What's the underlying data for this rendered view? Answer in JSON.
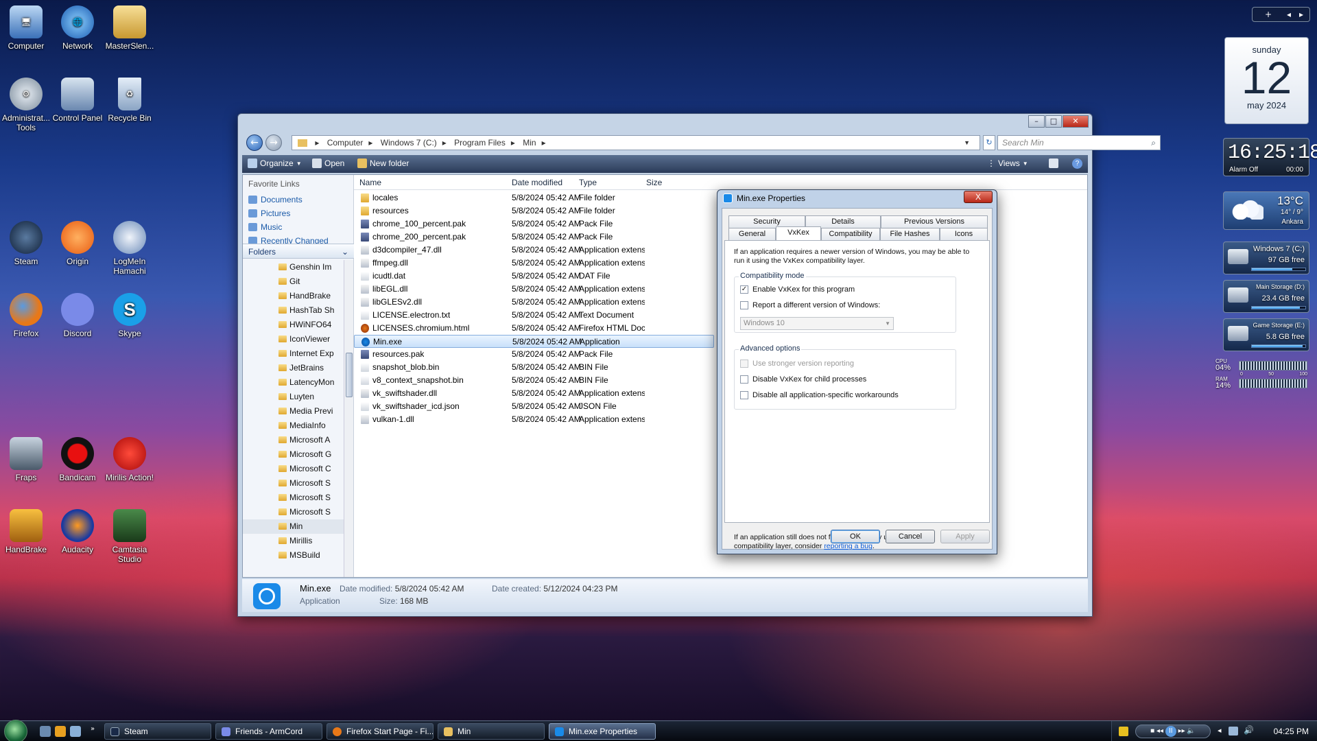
{
  "desktop": {
    "icons": [
      "Computer",
      "Network",
      "MasterSlen...",
      "Administrat... Tools",
      "Control Panel",
      "Recycle Bin",
      "Steam",
      "Origin",
      "LogMeIn Hamachi",
      "Firefox",
      "Discord",
      "Skype",
      "Fraps",
      "Bandicam",
      "Mirilis Action!",
      "HandBrake",
      "Audacity",
      "Camtasia Studio"
    ]
  },
  "explorer": {
    "breadcrumb": [
      "Computer",
      "Windows 7 (C:)",
      "Program Files",
      "Min"
    ],
    "search_placeholder": "Search Min",
    "toolbar": {
      "organize": "Organize",
      "open": "Open",
      "new_folder": "New folder",
      "views": "Views"
    },
    "favorite_links_title": "Favorite Links",
    "favorite_links": [
      "Documents",
      "Pictures",
      "Music",
      "Recently Changed"
    ],
    "folders_title": "Folders",
    "tree": [
      "Genshin Im",
      "Git",
      "HandBrake",
      "HashTab Sh",
      "HWiNFO64",
      "IconViewer",
      "Internet Exp",
      "JetBrains",
      "LatencyMon",
      "Luyten",
      "Media Previ",
      "MediaInfo",
      "Microsoft A",
      "Microsoft G",
      "Microsoft C",
      "Microsoft S",
      "Microsoft S",
      "Microsoft S",
      "Min",
      "Mirillis",
      "MSBuild"
    ],
    "columns": {
      "name": "Name",
      "date": "Date modified",
      "type": "Type",
      "size": "Size"
    },
    "files": [
      {
        "name": "locales",
        "date": "5/8/2024 05:42 AM",
        "type": "File folder",
        "icon": "folder"
      },
      {
        "name": "resources",
        "date": "5/8/2024 05:42 AM",
        "type": "File folder",
        "icon": "folder"
      },
      {
        "name": "chrome_100_percent.pak",
        "date": "5/8/2024 05:42 AM",
        "type": "Pack File",
        "icon": "pak"
      },
      {
        "name": "chrome_200_percent.pak",
        "date": "5/8/2024 05:42 AM",
        "type": "Pack File",
        "icon": "pak"
      },
      {
        "name": "d3dcompiler_47.dll",
        "date": "5/8/2024 05:42 AM",
        "type": "Application extens...",
        "icon": "dll"
      },
      {
        "name": "ffmpeg.dll",
        "date": "5/8/2024 05:42 AM",
        "type": "Application extens...",
        "icon": "dll"
      },
      {
        "name": "icudtl.dat",
        "date": "5/8/2024 05:42 AM",
        "type": "DAT File",
        "icon": "file"
      },
      {
        "name": "libEGL.dll",
        "date": "5/8/2024 05:42 AM",
        "type": "Application extens...",
        "icon": "dll"
      },
      {
        "name": "libGLESv2.dll",
        "date": "5/8/2024 05:42 AM",
        "type": "Application extens...",
        "icon": "dll"
      },
      {
        "name": "LICENSE.electron.txt",
        "date": "5/8/2024 05:42 AM",
        "type": "Text Document",
        "icon": "file"
      },
      {
        "name": "LICENSES.chromium.html",
        "date": "5/8/2024 05:42 AM",
        "type": "Firefox HTML Doc...",
        "icon": "html"
      },
      {
        "name": "Min.exe",
        "date": "5/8/2024 05:42 AM",
        "type": "Application",
        "icon": "exe"
      },
      {
        "name": "resources.pak",
        "date": "5/8/2024 05:42 AM",
        "type": "Pack File",
        "icon": "pak"
      },
      {
        "name": "snapshot_blob.bin",
        "date": "5/8/2024 05:42 AM",
        "type": "BIN File",
        "icon": "file"
      },
      {
        "name": "v8_context_snapshot.bin",
        "date": "5/8/2024 05:42 AM",
        "type": "BIN File",
        "icon": "file"
      },
      {
        "name": "vk_swiftshader.dll",
        "date": "5/8/2024 05:42 AM",
        "type": "Application extens...",
        "icon": "dll"
      },
      {
        "name": "vk_swiftshader_icd.json",
        "date": "5/8/2024 05:42 AM",
        "type": "JSON File",
        "icon": "file"
      },
      {
        "name": "vulkan-1.dll",
        "date": "5/8/2024 05:42 AM",
        "type": "Application extens...",
        "icon": "dll"
      }
    ],
    "details": {
      "name": "Min.exe",
      "kind": "Application",
      "modified_label": "Date modified:",
      "modified": "5/8/2024 05:42 AM",
      "size_label": "Size:",
      "size": "168 MB",
      "created_label": "Date created:",
      "created": "5/12/2024 04:23 PM"
    }
  },
  "dialog": {
    "title": "Min.exe Properties",
    "close": "X",
    "tabs_row1": [
      "Security",
      "Details",
      "Previous Versions"
    ],
    "tabs_row2": [
      "General",
      "VxKex",
      "Compatibility",
      "File Hashes",
      "Icons"
    ],
    "intro": "If an application requires a newer version of Windows, you may be able to run it using the VxKex compatibility layer.",
    "compat_title": "Compatibility mode",
    "enable_vxkex": "Enable VxKex for this program",
    "report_version": "Report a different version of Windows:",
    "version_value": "Windows 10",
    "advanced_title": "Advanced options",
    "stronger": "Use stronger version reporting",
    "disable_child": "Disable VxKex for child processes",
    "disable_workarounds": "Disable all application-specific workarounds",
    "footer_text": "If an application still does not function properly using the compatibility layer, consider ",
    "footer_link": "reporting a bug",
    "footer_end": ".",
    "ok": "OK",
    "cancel": "Cancel",
    "apply": "Apply"
  },
  "gadgets": {
    "calendar": {
      "day": "sunday",
      "date": "12",
      "month": "may 2024"
    },
    "clock": {
      "time": "16:25:18",
      "alarm": "Alarm Off",
      "alarm_time": "00:00"
    },
    "weather": {
      "temp": "13°C",
      "range": "14° / 9°",
      "city": "Ankara"
    },
    "drives": [
      {
        "name": "Windows 7 (C:)",
        "free": "97 GB free",
        "used": 0.75
      },
      {
        "name": "Main Storage (D:)",
        "free": "23.4 GB free",
        "used": 0.9
      },
      {
        "name": "Game Storage (E:)",
        "free": "5.8 GB free",
        "used": 0.95
      }
    ],
    "meter": {
      "cpu_label": "CPU",
      "cpu": "04%",
      "ram_label": "RAM",
      "ram": "14%",
      "scale": [
        "0",
        "50",
        "100"
      ]
    }
  },
  "taskbar": {
    "buttons": [
      "Steam",
      "Friends - ArmCord",
      "Firefox Start Page - Fi...",
      "Min",
      "Min.exe Properties"
    ],
    "time": "04:25 PM"
  }
}
